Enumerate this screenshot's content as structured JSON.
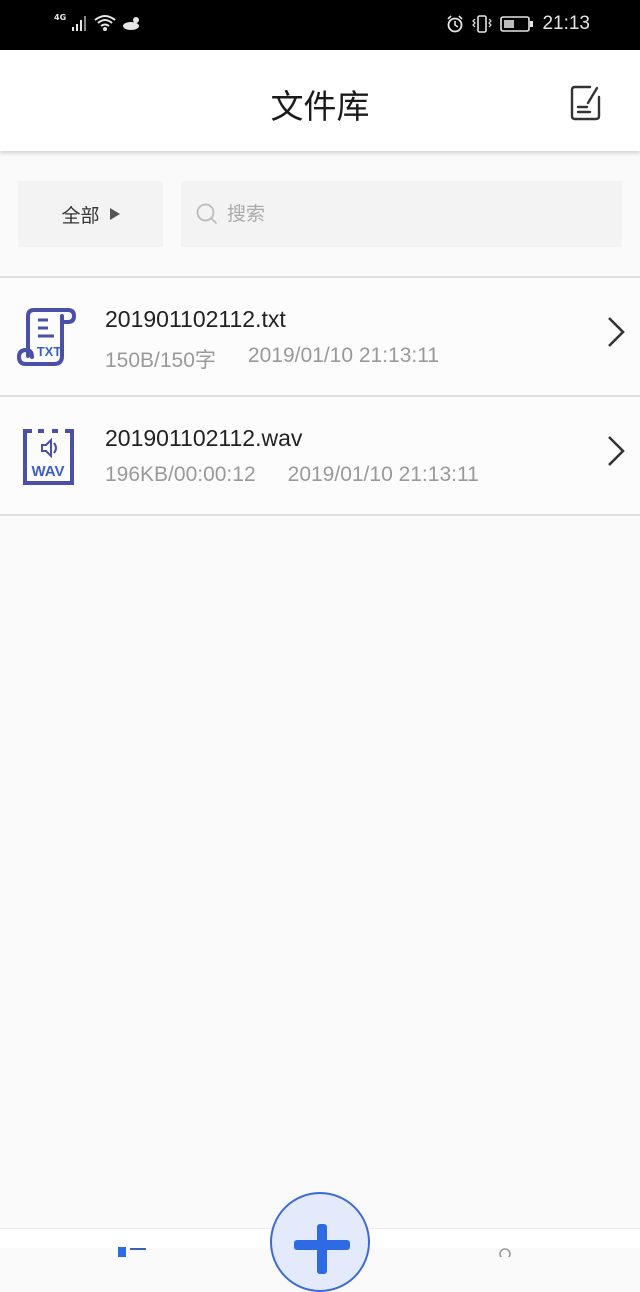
{
  "status_bar": {
    "network": "4G",
    "time": "21:13",
    "icons": [
      "signal-icon",
      "wifi-icon",
      "weather-icon",
      "alarm-icon",
      "vibrate-icon",
      "battery-icon"
    ]
  },
  "header": {
    "title": "文件库",
    "edit_icon": "edit-note-icon"
  },
  "filter": {
    "label": "全部",
    "search_placeholder": "搜索",
    "search_value": ""
  },
  "files": [
    {
      "name": "201901102112.txt",
      "size": "150B/150字",
      "date": "2019/01/10 21:13:11",
      "type": "txt",
      "type_label": "TXT"
    },
    {
      "name": "201901102112.wav",
      "size": "196KB/00:00:12",
      "date": "2019/01/10 21:13:11",
      "type": "wav",
      "type_label": "WAV"
    }
  ],
  "colors": {
    "icon_accent": "#4a4fa8",
    "fab_accent": "#2f6ae5",
    "fab_bg": "#e2eafb"
  }
}
